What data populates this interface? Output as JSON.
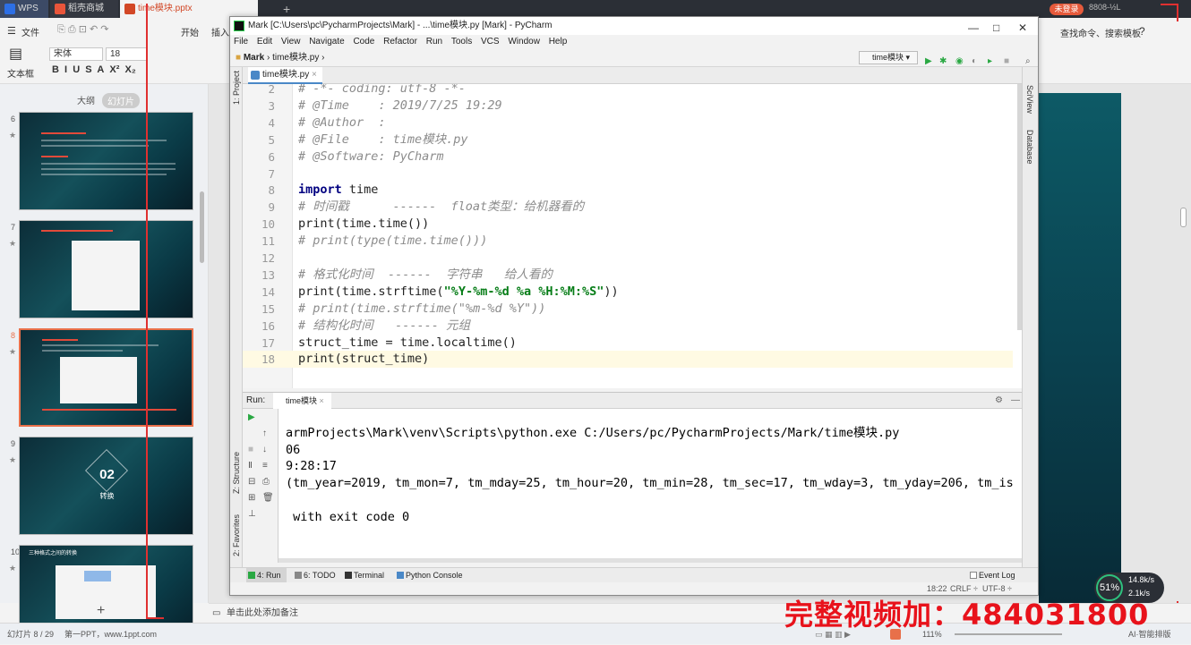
{
  "wps": {
    "tabs": [
      {
        "label": "WPS"
      },
      {
        "label": "稻壳商城"
      },
      {
        "label": "time模块.pptx"
      }
    ],
    "add_tab": "+",
    "login_badge": "未登录",
    "top_num": "8808-½L",
    "ribbon": {
      "file_menu": "文件",
      "start": "开始",
      "insert": "插入",
      "font_name": "宋体",
      "font_size": "18",
      "textbox": "文本框",
      "right_text": "查找命令、搜索模板",
      "help": "?"
    },
    "panel_tabs": {
      "outline": "大纲",
      "slides": "幻灯片"
    },
    "slides": [
      {
        "number": "6"
      },
      {
        "number": "7"
      },
      {
        "number": "8"
      },
      {
        "number": "9",
        "title": "02",
        "subtitle": "转换"
      },
      {
        "number": "10",
        "title": "三种格式之间的转换"
      }
    ],
    "add_slide": "+",
    "note_hint": "单击此处添加备注",
    "status_slide": "幻灯片 8 / 29",
    "status_theme": "第一PPT，www.1ppt.com",
    "zoom": "111%",
    "ai_label": "AI·智能排版"
  },
  "pycharm": {
    "title": "Mark [C:\\Users\\pc\\PycharmProjects\\Mark] - ...\\time模块.py [Mark] - PyCharm",
    "window_controls": [
      "—",
      "□",
      "✕"
    ],
    "menu": [
      "File",
      "Edit",
      "View",
      "Navigate",
      "Code",
      "Refactor",
      "Run",
      "Tools",
      "VCS",
      "Window",
      "Help"
    ],
    "breadcrumb": [
      "Mark",
      "time模块.py"
    ],
    "run_config": "time模块",
    "editor_tab": "time模块.py",
    "side_labels": {
      "project": "1: Project",
      "structure": "Z: Structure",
      "favorites": "2: Favorites",
      "sciview": "SciView",
      "database": "Database"
    },
    "code_lines": [
      {
        "n": "2",
        "text": "# -*- coding: utf-8 -*-",
        "type": "cmt"
      },
      {
        "n": "3",
        "text": "# @Time    : 2019/7/25 19:29",
        "type": "cmt"
      },
      {
        "n": "4",
        "text": "# @Author  :",
        "type": "cmt"
      },
      {
        "n": "5",
        "text": "# @File    : time模块.py",
        "type": "cmt"
      },
      {
        "n": "6",
        "text": "# @Software: PyCharm",
        "type": "cmt"
      },
      {
        "n": "7",
        "text": "",
        "type": "plain"
      },
      {
        "n": "8",
        "kw": "import",
        "text": " time",
        "type": "kw"
      },
      {
        "n": "9",
        "text": "# 时间戳      ------  float类型：给机器看的",
        "type": "cmt"
      },
      {
        "n": "10",
        "text": "print(time.time())",
        "type": "plain"
      },
      {
        "n": "11",
        "text": "# print(type(time.time()))",
        "type": "cmt"
      },
      {
        "n": "12",
        "text": "",
        "type": "plain"
      },
      {
        "n": "13",
        "text": "# 格式化时间  ------  字符串   给人看的",
        "type": "cmt"
      },
      {
        "n": "14",
        "pre": "print(time.strftime(",
        "str": "\"%Y-%m-%d %a %H:%M:%S\"",
        "post": "))",
        "type": "str"
      },
      {
        "n": "15",
        "text": "# print(time.strftime(\"%m-%d %Y\"))",
        "type": "cmt"
      },
      {
        "n": "16",
        "text": "# 结构化时间   ------ 元组",
        "type": "cmt"
      },
      {
        "n": "17",
        "text": "struct_time = time.localtime()",
        "type": "plain"
      },
      {
        "n": "18",
        "text": "print(struct_time)",
        "type": "plain"
      }
    ],
    "run_label": "Run:",
    "run_tab": "time模块",
    "console_lines": [
      "armProjects\\Mark\\venv\\Scripts\\python.exe C:/Users/pc/PycharmProjects/Mark/time模块.py",
      "06",
      "9:28:17",
      "(tm_year=2019, tm_mon=7, tm_mday=25, tm_hour=20, tm_min=28, tm_sec=17, tm_wday=3, tm_yday=206, tm_is",
      "",
      " with exit code 0"
    ],
    "bottom_tabs": [
      "4: Run",
      "6: TODO",
      "Terminal",
      "Python Console"
    ],
    "event_log": "Event Log",
    "status_pos": "18:22",
    "status_crlf": "CRLF ÷",
    "status_enc": "UTF-8 ÷"
  },
  "overlay": {
    "promo_text": "完整视频加：484031800",
    "speed_percent": "51%",
    "speed_up": "14.8k/s",
    "speed_down": "2.1k/s"
  },
  "colors": {
    "accent_red": "#e03030",
    "promo_red": "#e8121b",
    "slide_teal": "#14505a"
  }
}
